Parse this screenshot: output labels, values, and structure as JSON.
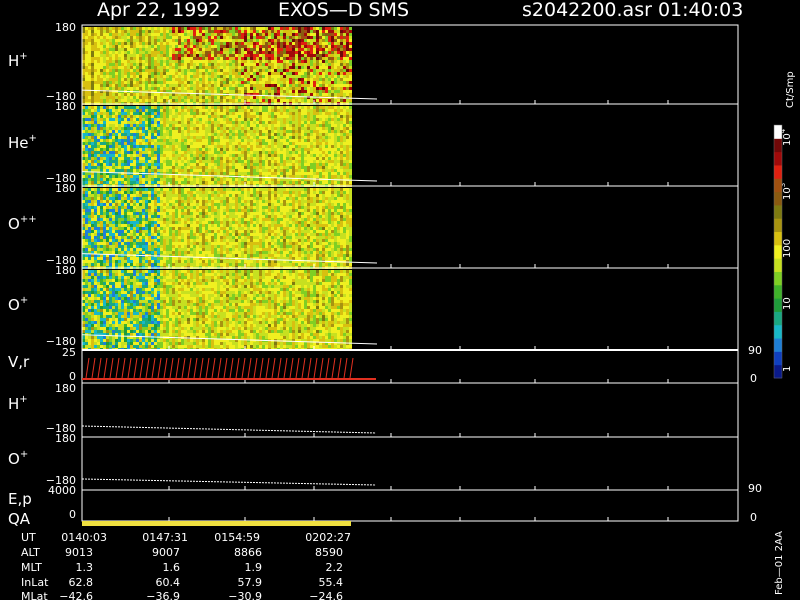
{
  "header": {
    "title": "Apr 22, 1992",
    "instrument": "EXOS—D SMS",
    "file": "s2042200.asr  01:40:03"
  },
  "panels": [
    {
      "label_base": "H",
      "label_sup": "+",
      "ytop": "180",
      "ybottom": "−180"
    },
    {
      "label_base": "He",
      "label_sup": "+",
      "ytop": "180",
      "ybottom": "−180"
    },
    {
      "label_base": "O",
      "label_sup": "++",
      "ytop": "180",
      "ybottom": "−180"
    },
    {
      "label_base": "O",
      "label_sup": "+",
      "ytop": "180",
      "ybottom": "−180"
    }
  ],
  "vr_panel": {
    "label": "V,r",
    "ytop": "25",
    "ybottom": "0",
    "right_top": "90",
    "right_bottom": "0"
  },
  "pitch_panels": [
    {
      "label_base": "H",
      "label_sup": "+",
      "ytop": "180",
      "ybottom": "−180"
    },
    {
      "label_base": "O",
      "label_sup": "+",
      "ytop": "180",
      "ybottom": "−180"
    }
  ],
  "ep_panel": {
    "label": "E,p",
    "ytop": "4000",
    "ybottom": "0",
    "right_top": "90",
    "right_bottom": "0"
  },
  "qa_panel": {
    "label": "QA"
  },
  "colorbar": {
    "unit": "Ct/Smp",
    "labels": [
      "1",
      "10",
      "100",
      "10",
      "10"
    ],
    "label_exps": [
      "3",
      "4"
    ],
    "colors": [
      "#0a1a8a",
      "#1040c0",
      "#1e7fd6",
      "#18b8c8",
      "#1aa882",
      "#1f9c3a",
      "#3fb22a",
      "#7fcf24",
      "#c7e020",
      "#f0f020",
      "#d8c010",
      "#a89410",
      "#7e7a10",
      "#8a5a10",
      "#a05010",
      "#e02010",
      "#a00a0a",
      "#700808",
      "#ffffff"
    ]
  },
  "ephemeris": {
    "rows": [
      {
        "label": "UT",
        "values": [
          "0140:03",
          "0147:31",
          "0154:59",
          "0202:27"
        ]
      },
      {
        "label": "ALT",
        "values": [
          "9013",
          "9007",
          "8866",
          "8590"
        ]
      },
      {
        "label": "MLT",
        "values": [
          "1.3",
          "1.6",
          "1.9",
          "2.2"
        ]
      },
      {
        "label": "InLat",
        "values": [
          "62.8",
          "60.4",
          "57.9",
          "55.4"
        ]
      },
      {
        "label": "MLat",
        "values": [
          "−42.6",
          "−36.9",
          "−30.9",
          "−24.6"
        ]
      }
    ]
  },
  "footer": {
    "stamp": "Feb—01 2AA"
  },
  "chart_data": {
    "type": "heatmap",
    "x": [
      "0140:03",
      "0147:31",
      "0154:59",
      "0202:27"
    ],
    "panel_ylim": [
      -180,
      180
    ],
    "vr_ylim": [
      0,
      25
    ],
    "ep_ylim": [
      0,
      4000
    ],
    "right_ylim": [
      0,
      90
    ],
    "colorbar_range": [
      1,
      10000
    ],
    "colorbar_scale": "log",
    "qa_color": "#f0e040",
    "trace_color": "#e03020"
  }
}
